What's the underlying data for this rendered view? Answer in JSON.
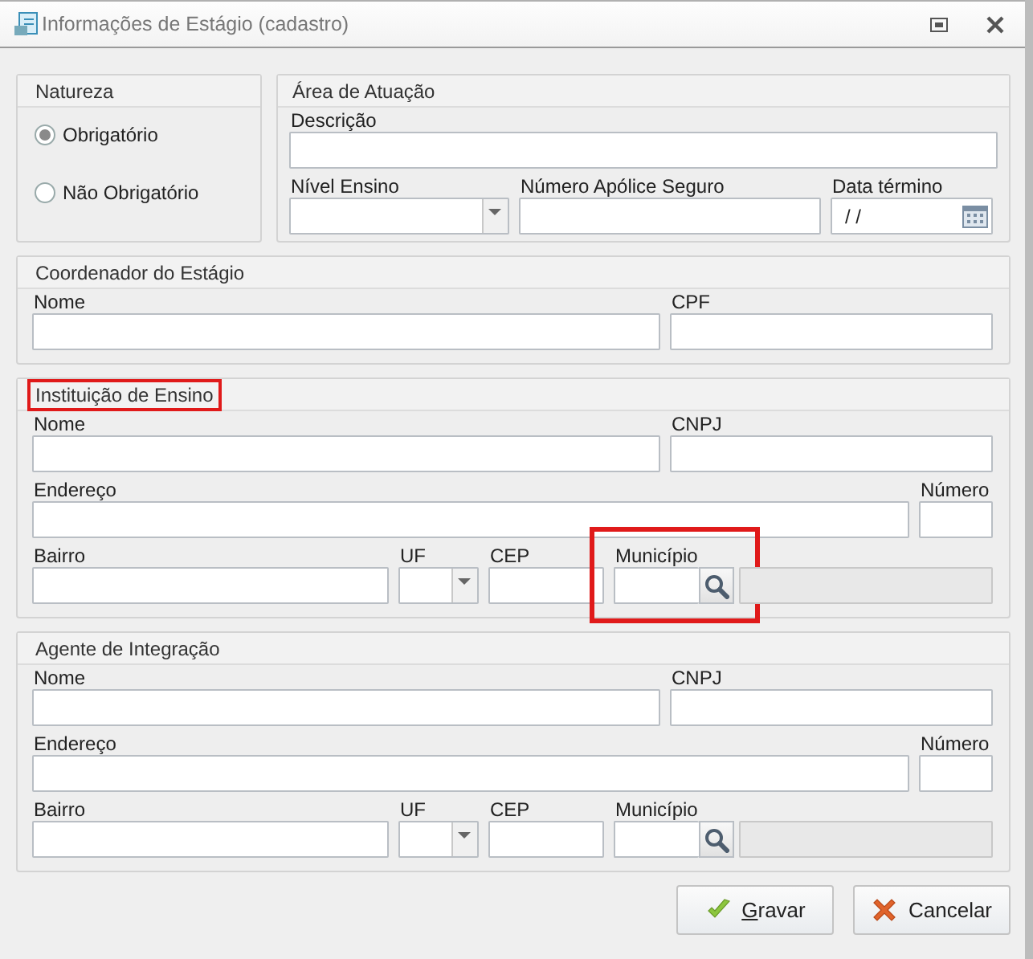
{
  "window": {
    "title": "Informações de Estágio (cadastro)"
  },
  "natureza": {
    "title": "Natureza",
    "options": [
      {
        "label": "Obrigatório",
        "selected": true
      },
      {
        "label": "Não Obrigatório",
        "selected": false
      }
    ]
  },
  "area_atuacao": {
    "title": "Área de Atuação",
    "highlighted": false,
    "fields": [
      {
        "label": "Descrição",
        "kind": "text"
      },
      {
        "label": "Nível Ensino",
        "kind": "combo"
      },
      {
        "label": "Número Apólice Seguro",
        "kind": "text"
      },
      {
        "label": "Data término",
        "kind": "date",
        "value": "/ /"
      }
    ]
  },
  "coordenador": {
    "title": "Coordenador do Estágio",
    "highlighted": false,
    "fields": [
      {
        "label": "Nome",
        "kind": "text"
      },
      {
        "label": "CPF",
        "kind": "text"
      }
    ]
  },
  "instituicao": {
    "title": "Instituição de Ensino",
    "highlighted": true,
    "fields": [
      {
        "label": "Nome",
        "kind": "text"
      },
      {
        "label": "CNPJ",
        "kind": "text"
      },
      {
        "label": "Endereço",
        "kind": "text"
      },
      {
        "label": "Número",
        "kind": "text"
      },
      {
        "label": "Bairro",
        "kind": "text"
      },
      {
        "label": "UF",
        "kind": "combo"
      },
      {
        "label": "CEP",
        "kind": "text"
      },
      {
        "label": "Município",
        "kind": "lookup",
        "highlighted": true
      }
    ]
  },
  "agente": {
    "title": "Agente de Integração",
    "highlighted": false,
    "fields": [
      {
        "label": "Nome",
        "kind": "text"
      },
      {
        "label": "CNPJ",
        "kind": "text"
      },
      {
        "label": "Endereço",
        "kind": "text"
      },
      {
        "label": "Número",
        "kind": "text"
      },
      {
        "label": "Bairro",
        "kind": "text"
      },
      {
        "label": "UF",
        "kind": "combo"
      },
      {
        "label": "CEP",
        "kind": "text"
      },
      {
        "label": "Município",
        "kind": "lookup"
      }
    ]
  },
  "buttons": [
    {
      "label": "Gravar",
      "kind": "save",
      "mnemonic": true
    },
    {
      "label": "Cancelar",
      "kind": "cancel",
      "mnemonic": false
    }
  ]
}
